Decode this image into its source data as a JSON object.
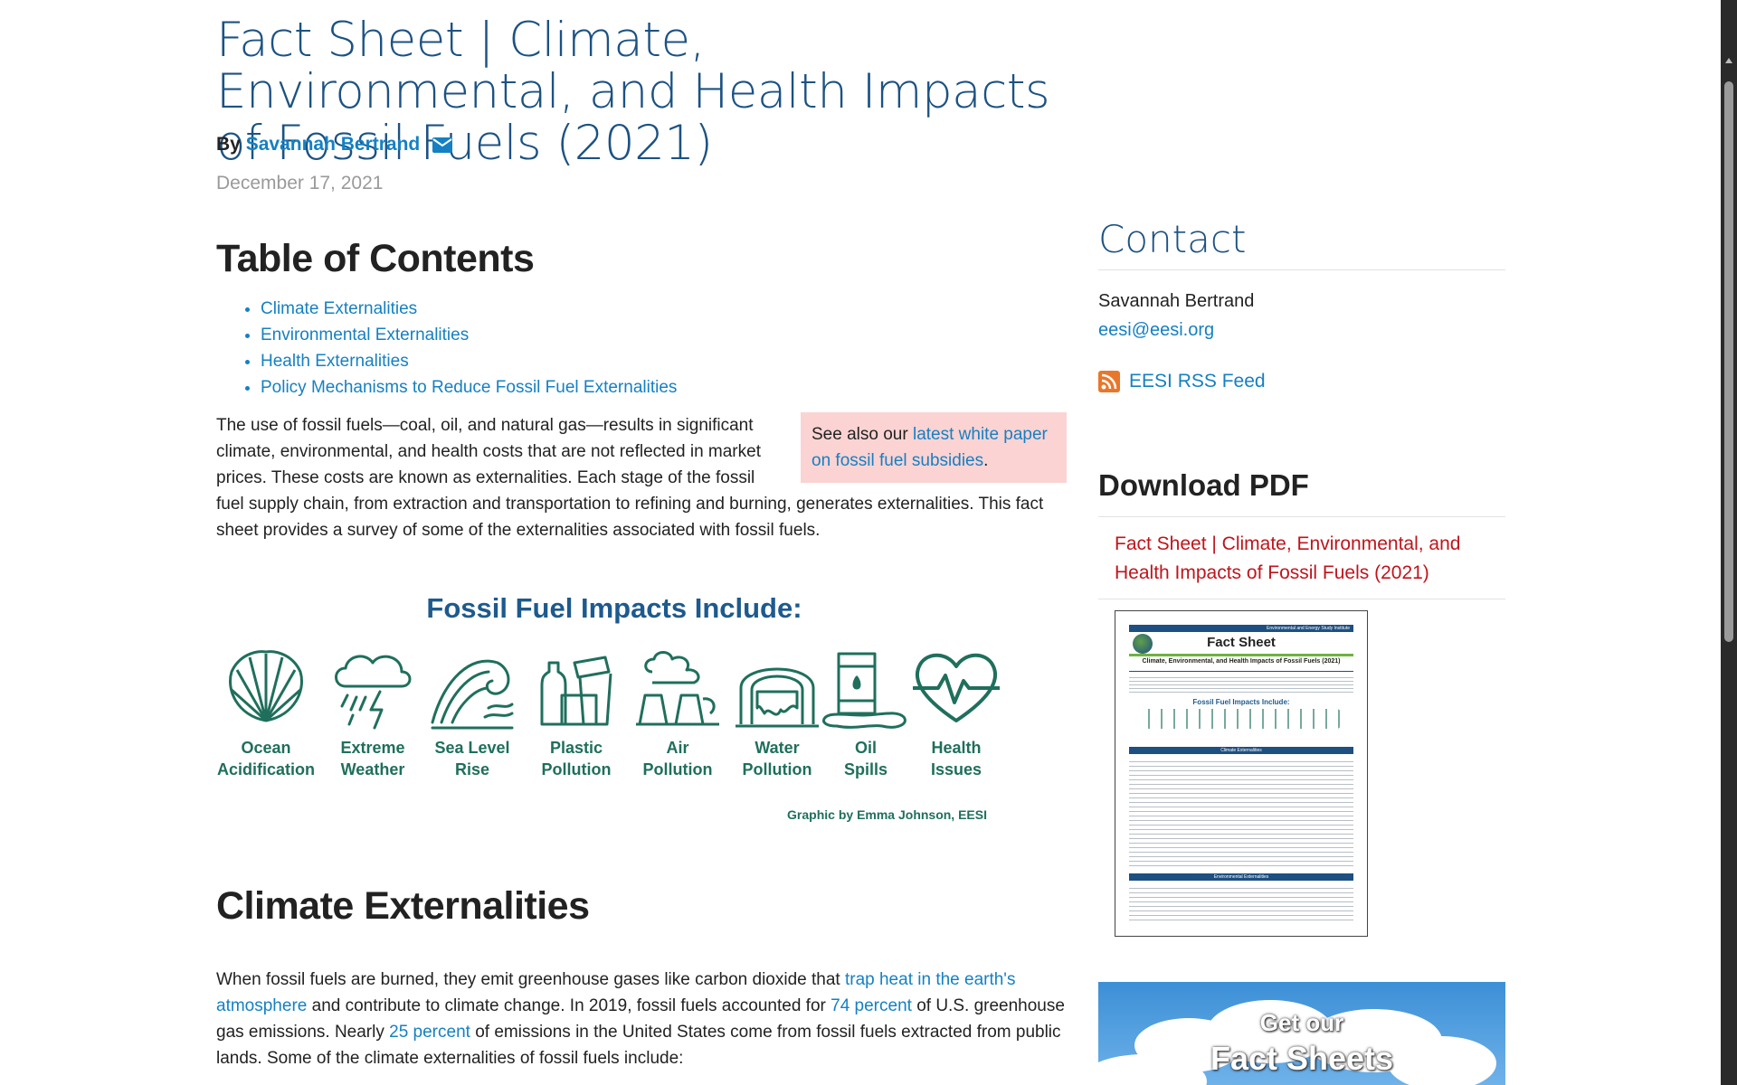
{
  "article": {
    "title": "Fact Sheet | Climate, Environmental, and Health Impacts of Fossil Fuels (2021)",
    "by_label": "By",
    "author": "Savannah Bertrand",
    "date": "December 17, 2021"
  },
  "toc": {
    "heading": "Table of Contents",
    "items": [
      "Climate Externalities",
      "Environmental Externalities",
      "Health Externalities",
      "Policy Mechanisms to Reduce Fossil Fuel Externalities"
    ]
  },
  "note": {
    "prefix": "See also our ",
    "link": "latest white paper on fossil fuel subsidies",
    "suffix": "."
  },
  "intro": "The use of fossil fuels—coal, oil, and natural gas—results in significant climate, environmental, and health costs that are not reflected in market prices. These costs are known as externalities. Each stage of the fossil fuel supply chain, from extraction and transportation to refining and burning, generates externalities. This fact sheet provides a survey of some of the externalities associated with fossil fuels.",
  "graphic": {
    "title": "Fossil Fuel Impacts Include:",
    "items": [
      {
        "line1": "Ocean",
        "line2": "Acidification",
        "icon": "shell-icon"
      },
      {
        "line1": "Extreme",
        "line2": "Weather",
        "icon": "storm-cloud-icon"
      },
      {
        "line1": "Sea Level",
        "line2": "Rise",
        "icon": "wave-icon"
      },
      {
        "line1": "Plastic",
        "line2": "Pollution",
        "icon": "plastic-bottle-icon"
      },
      {
        "line1": "Air",
        "line2": "Pollution",
        "icon": "factory-icon"
      },
      {
        "line1": "Water",
        "line2": "Pollution",
        "icon": "water-drain-icon"
      },
      {
        "line1": "Oil",
        "line2": "Spills",
        "icon": "oil-barrel-icon"
      },
      {
        "line1": "Health",
        "line2": "Issues",
        "icon": "heartbeat-icon"
      }
    ],
    "credit": "Graphic by Emma Johnson, EESI"
  },
  "climate": {
    "heading": "Climate Externalities",
    "p1": "When fossil fuels are burned, they emit greenhouse gases like carbon dioxide that ",
    "link1": "trap heat in the earth's atmosphere",
    "p2": " and contribute to climate change. In 2019, fossil fuels accounted for ",
    "link2": "74 percent",
    "p3": " of U.S. greenhouse gas emissions. Nearly ",
    "link3": "25 percent",
    "p4": " of emissions in the United States come from fossil fuels extracted from public lands. Some of the climate externalities of fossil fuels include:"
  },
  "sidebar": {
    "contact_heading": "Contact",
    "contact_name": "Savannah Bertrand",
    "contact_email": "eesi@eesi.org",
    "rss_label": "EESI RSS Feed",
    "download_heading": "Download PDF",
    "download_link": "Fact Sheet | Climate, Environmental, and Health Impacts of Fossil Fuels (2021)",
    "thumbnail": {
      "header_small": "Environmental and Energy Study Institute",
      "title": "Fact Sheet",
      "subtitle": "Climate, Environmental, and Health Impacts of Fossil Fuels (2021)",
      "impacts_title": "Fossil Fuel Impacts Include:",
      "section1": "Climate Externalities",
      "section2": "Environmental Externalities"
    },
    "banner_line1": "Get our",
    "banner_line2": "Fact Sheets"
  },
  "colors": {
    "title_blue": "#1c5283",
    "link_blue": "#1580c3",
    "graphic_green": "#1f6f5c",
    "download_red": "#c0141b",
    "note_pink": "#fbd3d3"
  }
}
